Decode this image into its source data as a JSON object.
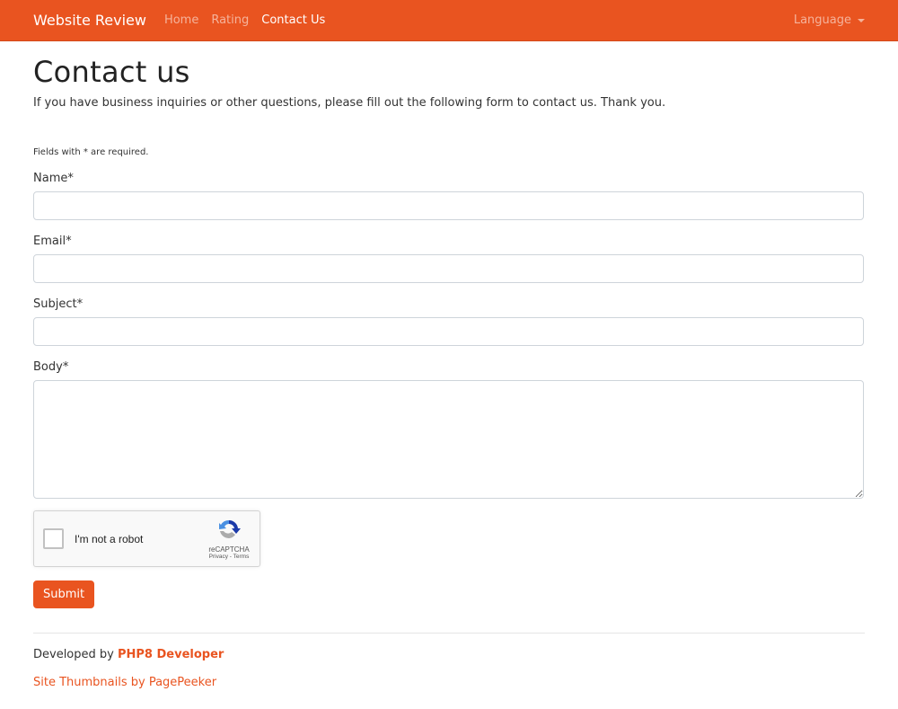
{
  "navbar": {
    "brand": "Website Review",
    "links": [
      {
        "label": "Home"
      },
      {
        "label": "Rating"
      },
      {
        "label": "Contact Us"
      }
    ],
    "language_label": "Language"
  },
  "page": {
    "title": "Contact us",
    "intro": "If you have business inquiries or other questions, please fill out the following form to contact us. Thank you.",
    "required_note": "Fields with * are required."
  },
  "form": {
    "name_label": "Name*",
    "name_value": "",
    "email_label": "Email*",
    "email_value": "",
    "subject_label": "Subject*",
    "subject_value": "",
    "body_label": "Body*",
    "body_value": "",
    "recaptcha": {
      "label": "I'm not a robot",
      "brand": "reCAPTCHA",
      "terms": "Privacy - Terms"
    },
    "submit_label": "Submit"
  },
  "footer": {
    "developed_by": "Developed by ",
    "developer_link": "PHP8 Developer",
    "thumbnails_link": "Site Thumbnails by PagePeeker"
  },
  "colors": {
    "brand": "#e95420"
  }
}
